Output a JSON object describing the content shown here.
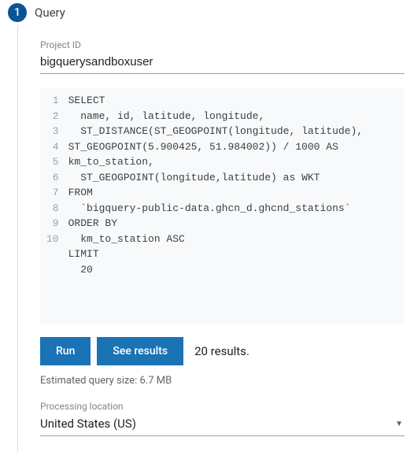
{
  "step": {
    "number": "1",
    "title": "Query"
  },
  "project": {
    "label": "Project ID",
    "value": "bigquerysandboxuser"
  },
  "code": {
    "lines": [
      "SELECT",
      "  name, id, latitude, longitude,",
      "  ST_DISTANCE(ST_GEOGPOINT(longitude, latitude), ST_GEOGPOINT(5.900425, 51.984002)) / 1000 AS km_to_station,",
      "  ST_GEOGPOINT(longitude,latitude) as WKT",
      "FROM",
      "  `bigquery-public-data.ghcn_d.ghcnd_stations`",
      "ORDER BY",
      "  km_to_station ASC",
      "LIMIT",
      "  20"
    ]
  },
  "buttons": {
    "run": "Run",
    "see_results": "See results"
  },
  "results_text": "20 results.",
  "estimated": "Estimated query size: 6.7 MB",
  "location": {
    "label": "Processing location",
    "value": "United States (US)"
  }
}
